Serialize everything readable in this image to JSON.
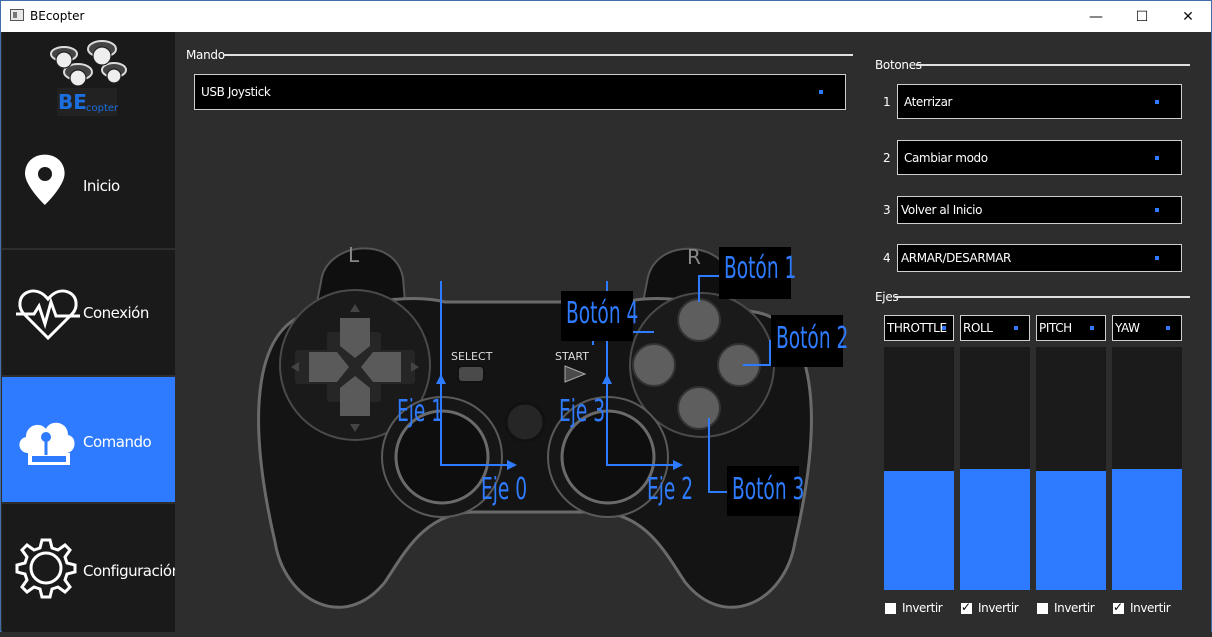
{
  "window": {
    "title": "BEcopter",
    "minimize_glyph": "—",
    "maximize_glyph": "☐",
    "close_glyph": "✕"
  },
  "logo": {
    "text_be": "BE",
    "text_copter": "copter"
  },
  "sidebar": {
    "items": [
      {
        "label": "Inicio",
        "icon": "location-pin-icon",
        "active": false
      },
      {
        "label": "Conexión",
        "icon": "heartbeat-icon",
        "active": false
      },
      {
        "label": "Comando",
        "icon": "cloud-joystick-icon",
        "active": true
      },
      {
        "label": "Configuración",
        "icon": "gear-icon",
        "active": false
      }
    ]
  },
  "mando": {
    "label": "Mando",
    "selected": "USB Joystick"
  },
  "gamepad": {
    "l_label": "L",
    "r_label": "R",
    "select_label": "SELECT",
    "start_label": "START",
    "annotations": {
      "boton1": "Botón 1",
      "boton2": "Botón 2",
      "boton3": "Botón 3",
      "boton4": "Botón 4",
      "eje0": "Eje 0",
      "eje1": "Eje 1",
      "eje2": "Eje 2",
      "eje3": "Eje 3"
    }
  },
  "botones": {
    "label": "Botones",
    "rows": [
      {
        "num": "1",
        "value": "Aterrizar"
      },
      {
        "num": "2",
        "value": "Cambiar modo"
      },
      {
        "num": "3",
        "value": "Volver al Inicio"
      },
      {
        "num": "4",
        "value": "ARMAR/DESARMAR"
      }
    ]
  },
  "ejes": {
    "label": "Ejes",
    "axes": [
      {
        "name": "THROTTLE",
        "level": 0.49,
        "invert_label": "Invertir",
        "inverted": false
      },
      {
        "name": "ROLL",
        "level": 0.5,
        "invert_label": "Invertir",
        "inverted": true
      },
      {
        "name": "PITCH",
        "level": 0.49,
        "invert_label": "Invertir",
        "inverted": false
      },
      {
        "name": "YAW",
        "level": 0.5,
        "invert_label": "Invertir",
        "inverted": true
      }
    ]
  },
  "colors": {
    "accent": "#2f7bff",
    "sidebar_bg": "#1a1a1a",
    "main_bg": "#2d2d2d"
  }
}
